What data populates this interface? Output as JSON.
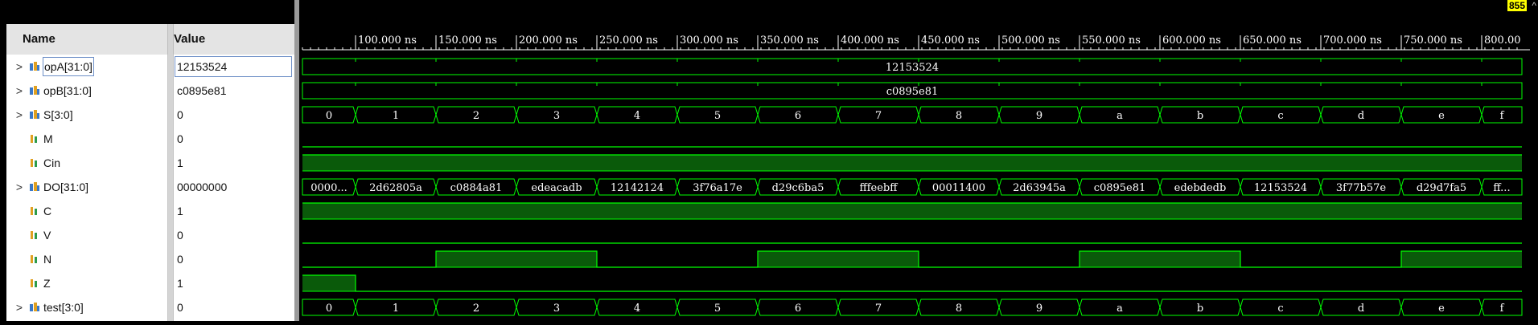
{
  "header": {
    "name": "Name",
    "value": "Value"
  },
  "cursor_marker": "855",
  "timeline": {
    "ticks": [
      "100.000 ns",
      "150.000 ns",
      "200.000 ns",
      "250.000 ns",
      "300.000 ns",
      "350.000 ns",
      "400.000 ns",
      "450.000 ns",
      "500.000 ns",
      "550.000 ns",
      "600.000 ns",
      "650.000 ns",
      "700.000 ns",
      "750.000 ns",
      "800.00"
    ]
  },
  "signals": [
    {
      "name": "opA[31:0]",
      "value": "12153524",
      "kind": "bus",
      "expand": true
    },
    {
      "name": "opB[31:0]",
      "value": "c0895e81",
      "kind": "bus",
      "expand": true
    },
    {
      "name": "S[3:0]",
      "value": "0",
      "kind": "bus",
      "expand": true
    },
    {
      "name": "M",
      "value": "0",
      "kind": "bit",
      "expand": false
    },
    {
      "name": "Cin",
      "value": "1",
      "kind": "bit",
      "expand": false
    },
    {
      "name": "DO[31:0]",
      "value": "00000000",
      "kind": "bus",
      "expand": true
    },
    {
      "name": "C",
      "value": "1",
      "kind": "bit",
      "expand": false
    },
    {
      "name": "V",
      "value": "0",
      "kind": "bit",
      "expand": false
    },
    {
      "name": "N",
      "value": "0",
      "kind": "bit",
      "expand": false
    },
    {
      "name": "Z",
      "value": "1",
      "kind": "bit",
      "expand": false
    },
    {
      "name": "test[3:0]",
      "value": "0",
      "kind": "bus",
      "expand": true
    }
  ],
  "waves": {
    "opA": {
      "type": "bus",
      "labels": [
        "12153524"
      ]
    },
    "opB": {
      "type": "bus",
      "labels": [
        "c0895e81"
      ]
    },
    "S": {
      "type": "bus",
      "labels": [
        "0",
        "1",
        "2",
        "3",
        "4",
        "5",
        "6",
        "7",
        "8",
        "9",
        "a",
        "b",
        "c",
        "d",
        "e",
        "f"
      ]
    },
    "M": {
      "type": "bit",
      "levels": [
        0,
        0,
        0,
        0,
        0,
        0,
        0,
        0,
        0,
        0,
        0,
        0,
        0,
        0,
        0,
        0
      ]
    },
    "Cin": {
      "type": "bit",
      "levels": [
        1,
        1,
        1,
        1,
        1,
        1,
        1,
        1,
        1,
        1,
        1,
        1,
        1,
        1,
        1,
        1
      ]
    },
    "DO": {
      "type": "bus",
      "labels": [
        "0000...",
        "2d62805a",
        "c0884a81",
        "edeacadb",
        "12142124",
        "3f76a17e",
        "d29c6ba5",
        "fffeebff",
        "00011400",
        "2d63945a",
        "c0895e81",
        "edebdedb",
        "12153524",
        "3f77b57e",
        "d29d7fa5",
        "ff..."
      ]
    },
    "C": {
      "type": "bit",
      "levels": [
        1,
        1,
        1,
        1,
        1,
        1,
        1,
        1,
        1,
        1,
        1,
        1,
        1,
        1,
        1,
        1
      ]
    },
    "V": {
      "type": "bit",
      "levels": [
        0,
        0,
        0,
        0,
        0,
        0,
        0,
        0,
        0,
        0,
        0,
        0,
        0,
        0,
        0,
        0
      ]
    },
    "N": {
      "type": "bit",
      "levels": [
        0,
        0,
        1,
        1,
        0,
        0,
        1,
        1,
        0,
        0,
        1,
        1,
        0,
        0,
        1,
        1
      ]
    },
    "Z": {
      "type": "bit",
      "levels": [
        1,
        0,
        0,
        0,
        0,
        0,
        0,
        0,
        0,
        0,
        0,
        0,
        0,
        0,
        0,
        0
      ]
    },
    "test": {
      "type": "bus",
      "labels": [
        "0",
        "1",
        "2",
        "3",
        "4",
        "5",
        "6",
        "7",
        "8",
        "9",
        "a",
        "b",
        "c",
        "d",
        "e",
        "f"
      ]
    }
  },
  "colors": {
    "wave": "#00ff00",
    "fill": "#0a5a0a",
    "bg": "#000000",
    "marker": "#ffff00"
  }
}
